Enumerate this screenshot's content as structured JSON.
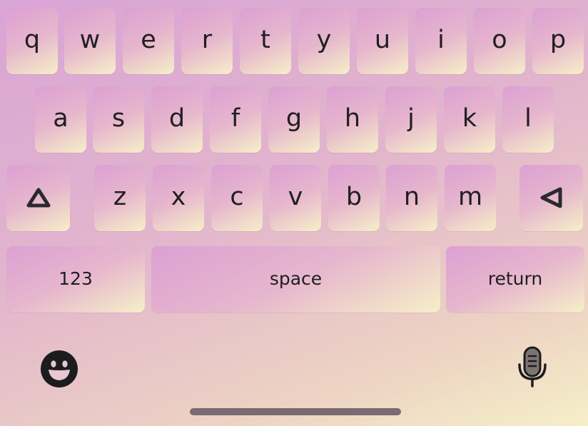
{
  "keyboard": {
    "row1": [
      "q",
      "w",
      "e",
      "r",
      "t",
      "y",
      "u",
      "i",
      "o",
      "p"
    ],
    "row2": [
      "a",
      "s",
      "d",
      "f",
      "g",
      "h",
      "j",
      "k",
      "l"
    ],
    "row3": [
      "z",
      "x",
      "c",
      "v",
      "b",
      "n",
      "m"
    ],
    "numbers_label": "123",
    "space_label": "space",
    "return_label": "return",
    "icons": {
      "shift": "shift-icon",
      "backspace": "backspace-icon",
      "emoji": "emoji-icon",
      "microphone": "microphone-icon"
    }
  }
}
